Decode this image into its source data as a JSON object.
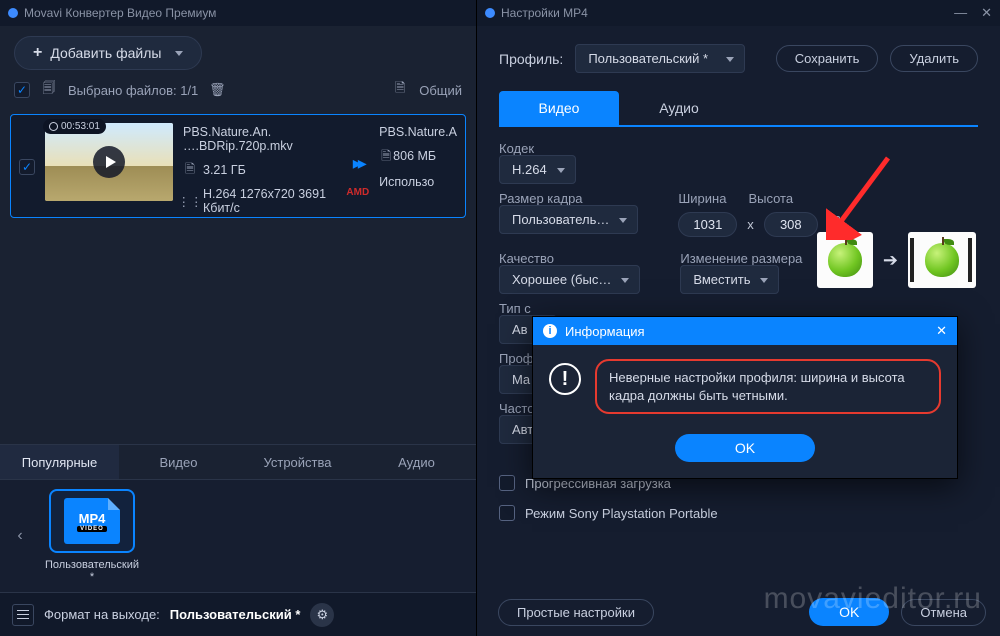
{
  "main": {
    "title": "Movavi Конвертер Видео Премиум",
    "add_files": "Добавить файлы",
    "selected": "Выбрано файлов: 1/1",
    "general": "Общий",
    "file": {
      "duration": "00:53:01",
      "name": "PBS.Nature.An. ….BDRip.720p.mkv",
      "size": "3.21 ГБ",
      "info": "H.264 1276x720 3691 Кбит/с",
      "out_name": "PBS.Nature.A",
      "out_size": "806 МБ",
      "out_use": "Использо"
    },
    "tabs": {
      "popular": "Популярные",
      "video": "Видео",
      "devices": "Устройства",
      "audio": "Аудио"
    },
    "preset_label": "Пользовательский *",
    "mp4": "MP4",
    "mp4_sub": "VIDEO",
    "format_label": "Формат на выходе:",
    "format_value": "Пользовательский *"
  },
  "settings": {
    "title": "Настройки MP4",
    "profile_label": "Профиль:",
    "profile_value": "Пользовательский *",
    "save": "Сохранить",
    "delete": "Удалить",
    "tab_video": "Видео",
    "tab_audio": "Аудио",
    "codec_label": "Кодек",
    "codec_value": "H.264",
    "frame_label": "Размер кадра",
    "frame_value": "Пользователь…",
    "width_label": "Ширина",
    "height_label": "Высота",
    "width": "1031",
    "height": "308",
    "quality_label": "Качество",
    "quality_value": "Хорошее (быс…",
    "resize_label": "Изменение размера",
    "resize_value": "Вместить",
    "type_label": "Тип с",
    "type_value": "Ав",
    "pro_label": "Проф",
    "pro_value": "Ma",
    "fps_label": "Частота кадров",
    "fps_value": "Авто",
    "progressive": "Прогрессивная загрузка",
    "psp": "Режим Sony Playstation Portable",
    "simple": "Простые настройки",
    "ok": "OK",
    "cancel": "Отмена"
  },
  "dialog": {
    "title": "Информация",
    "message": "Неверные настройки профиля: ширина и высота кадра должны быть четными.",
    "ok": "OK"
  },
  "watermark": "movavieditor.ru"
}
